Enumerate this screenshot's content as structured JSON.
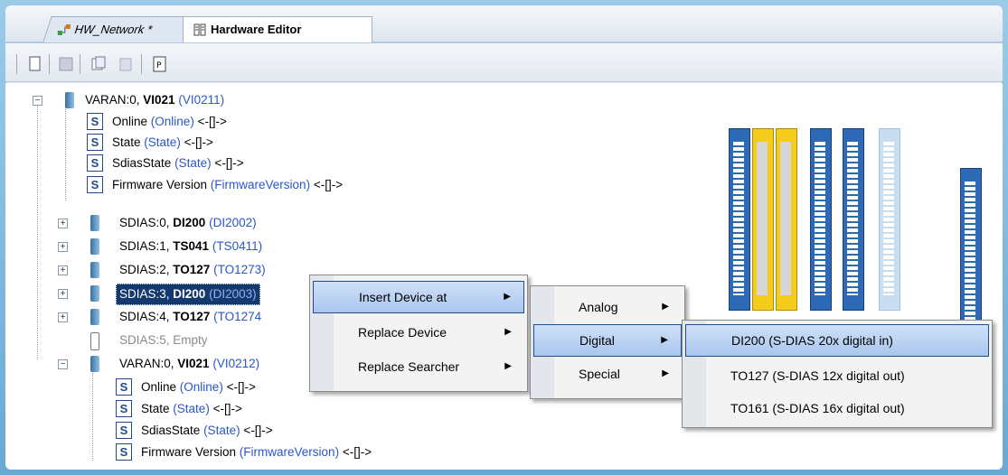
{
  "tabs": [
    {
      "label": "HW_Network *",
      "icon": "network-icon"
    },
    {
      "label": "Hardware Editor",
      "icon": "hardware-editor-icon"
    }
  ],
  "toolbar": {
    "buttons": [
      "new-icon",
      "save-icon",
      "copy-icon",
      "paste-icon",
      "properties-icon"
    ]
  },
  "tree": {
    "root1": {
      "prefix": "VARAN:0, ",
      "name": "VI021",
      "type": "(VI0211)"
    },
    "root1_children": [
      {
        "label": "Online",
        "type": "(Online)",
        "suffix": " <-[]->"
      },
      {
        "label": "State",
        "type": "(State)",
        "suffix": " <-[]->"
      },
      {
        "label": "SdiasState",
        "type": "(State)",
        "suffix": " <-[]->"
      },
      {
        "label": "Firmware Version",
        "type": "(FirmwareVersion)",
        "suffix": " <-[]->"
      }
    ],
    "sdias": [
      {
        "prefix": "SDIAS:0, ",
        "name": "DI200",
        "type": "(DI2002)"
      },
      {
        "prefix": "SDIAS:1, ",
        "name": "TS041",
        "type": "(TS0411)"
      },
      {
        "prefix": "SDIAS:2, ",
        "name": "TO127",
        "type": "(TO1273)"
      },
      {
        "prefix": "SDIAS:3, ",
        "name": "DI200",
        "type": "(DI2003)"
      },
      {
        "prefix": "SDIAS:4, ",
        "name": "TO127",
        "type": "(TO1274"
      },
      {
        "prefix": "SDIAS:5, Empty",
        "name": "",
        "type": ""
      }
    ],
    "root2": {
      "prefix": "VARAN:0, ",
      "name": "VI021",
      "type": "(VI0212)"
    },
    "root2_children": [
      {
        "label": "Online",
        "type": "(Online)",
        "suffix": " <-[]->"
      },
      {
        "label": "State",
        "type": "(State)",
        "suffix": " <-[]->"
      },
      {
        "label": "SdiasState",
        "type": "(State)",
        "suffix": " <-[]->"
      },
      {
        "label": "Firmware Version",
        "type": "(FirmwareVersion)",
        "suffix": " <-[]->"
      }
    ]
  },
  "context_menu": {
    "items": [
      {
        "label": "Insert Device at",
        "underline": "I",
        "highlighted": true
      },
      {
        "label": "Replace Device",
        "underline": "R",
        "highlighted": false
      },
      {
        "label": "Replace Searcher",
        "underline": "e",
        "highlighted": false
      }
    ]
  },
  "submenu_insert": {
    "items": [
      {
        "label": "Analog",
        "highlighted": false
      },
      {
        "label": "Digital",
        "highlighted": true
      },
      {
        "label": "Special",
        "highlighted": false
      }
    ]
  },
  "submenu_digital": {
    "items": [
      {
        "label": "DI200 (S-DIAS 20x digital in)",
        "highlighted": true
      },
      {
        "label": "TO127 (S-DIAS 12x digital out)",
        "highlighted": false
      },
      {
        "label": "TO161 (S-DIAS 16x digital out)",
        "highlighted": false
      }
    ]
  },
  "colors": {
    "selection": "#14396f",
    "type_text": "#2a56c6",
    "module_blue": "#2c6ab6",
    "module_yellow": "#f3cc1c"
  }
}
